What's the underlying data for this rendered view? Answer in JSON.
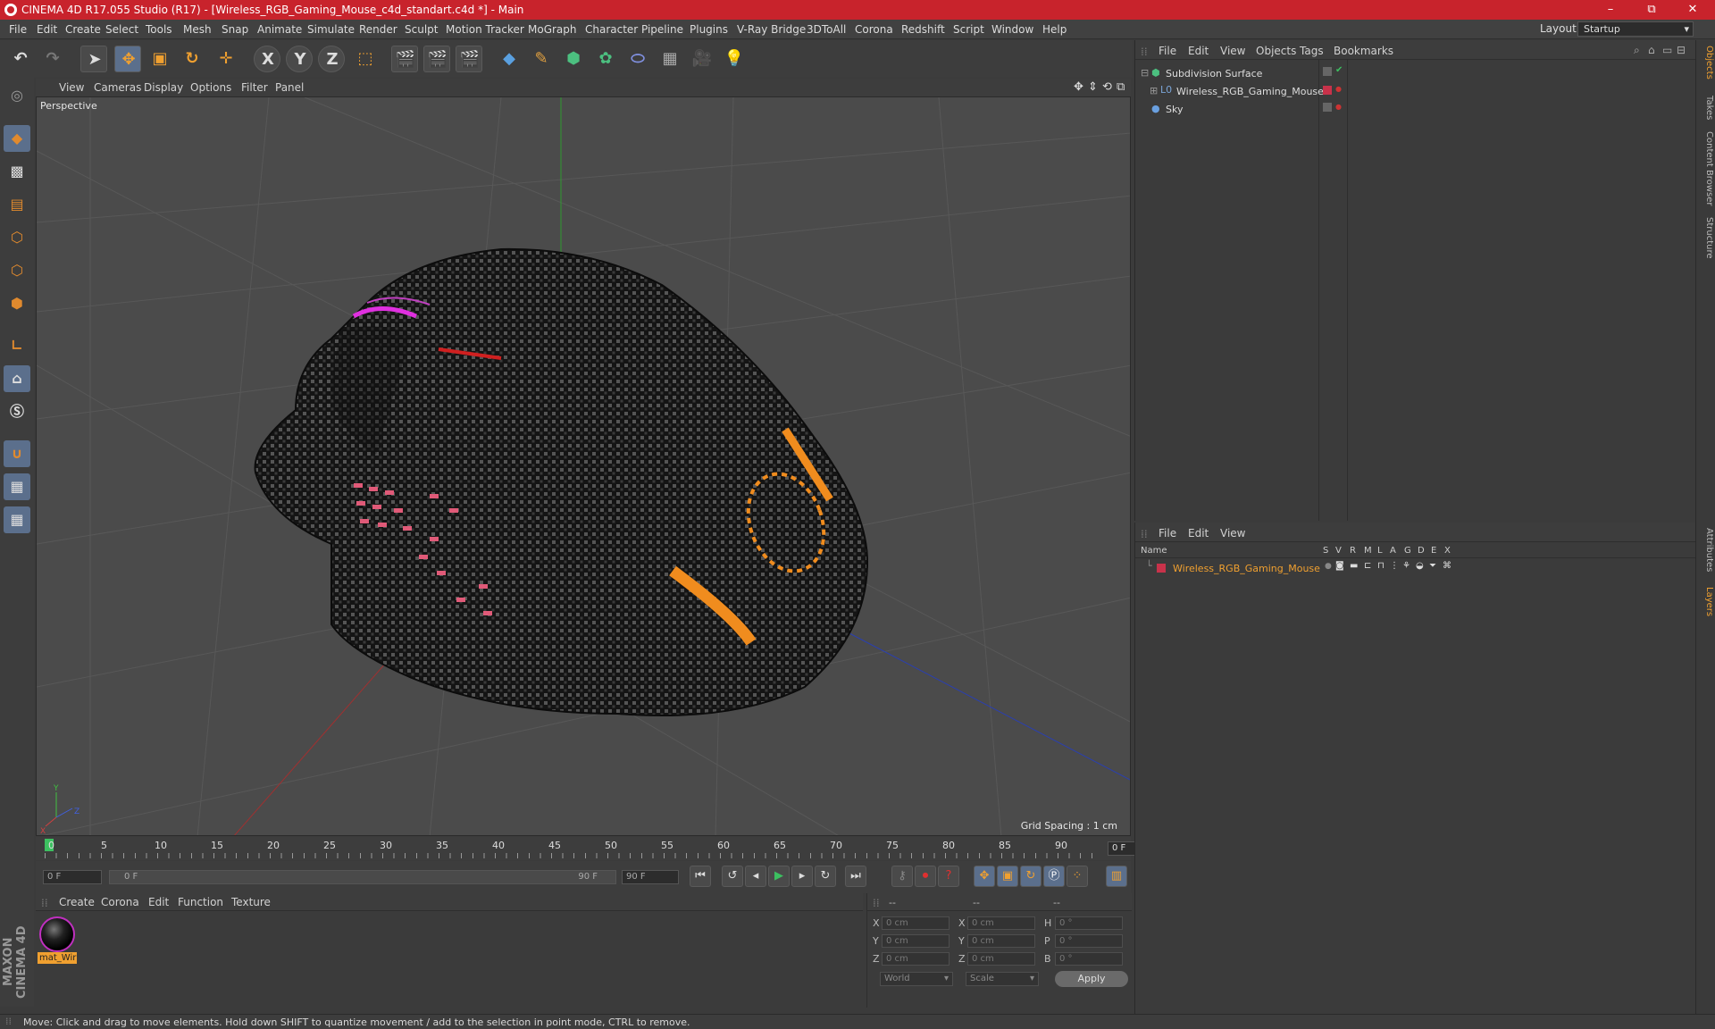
{
  "window": {
    "title": "CINEMA 4D R17.055 Studio (R17) - [Wireless_RGB_Gaming_Mouse_c4d_standart.c4d *] - Main",
    "minimize": "–",
    "restore": "⧉",
    "close": "✕"
  },
  "menu": [
    "File",
    "Edit",
    "Create",
    "Select",
    "Tools",
    "Mesh",
    "Snap",
    "Animate",
    "Simulate",
    "Render",
    "Sculpt",
    "Motion Tracker",
    "MoGraph",
    "Character",
    "Pipeline",
    "Plugins",
    "V-Ray Bridge",
    "3DToAll",
    "Corona",
    "Redshift",
    "Script",
    "Window",
    "Help"
  ],
  "layout": {
    "label": "Layout:",
    "value": "Startup"
  },
  "toolbar": {
    "axis_x": "X",
    "axis_y": "Y",
    "axis_z": "Z"
  },
  "viewport": {
    "menu": [
      "View",
      "Cameras",
      "Display",
      "Options",
      "Filter",
      "Panel"
    ],
    "label": "Perspective",
    "grid_spacing": "Grid Spacing : 1 cm",
    "axis_labels": {
      "y": "Y",
      "x": "X",
      "z": "Z"
    }
  },
  "timeline": {
    "ticks": [
      "0",
      "5",
      "10",
      "15",
      "20",
      "25",
      "30",
      "35",
      "40",
      "45",
      "50",
      "55",
      "60",
      "65",
      "70",
      "75",
      "80",
      "85",
      "90"
    ],
    "current_frame": "0 F",
    "start_field": "0 F",
    "range_start": "0 F",
    "range_end": "90 F",
    "end_field": "90 F"
  },
  "material_manager": {
    "menu": [
      "Create",
      "Corona",
      "Edit",
      "Function",
      "Texture"
    ],
    "material_name": "mat_Wir"
  },
  "coordinates": {
    "headers": [
      "--",
      "--",
      "--"
    ],
    "rows": [
      {
        "l1": "X",
        "v1": "0 cm",
        "l2": "X",
        "v2": "0 cm",
        "l3": "H",
        "v3": "0 °"
      },
      {
        "l1": "Y",
        "v1": "0 cm",
        "l2": "Y",
        "v2": "0 cm",
        "l3": "P",
        "v3": "0 °"
      },
      {
        "l1": "Z",
        "v1": "0 cm",
        "l2": "Z",
        "v2": "0 cm",
        "l3": "B",
        "v3": "0 °"
      }
    ],
    "mode": "World",
    "scale": "Scale",
    "apply": "Apply"
  },
  "object_manager": {
    "menu": [
      "File",
      "Edit",
      "View",
      "Objects",
      "Tags",
      "Bookmarks"
    ],
    "objects": [
      {
        "name": "Subdivision Surface"
      },
      {
        "name": "Wireless_RGB_Gaming_Mouse"
      },
      {
        "name": "Sky"
      }
    ]
  },
  "layer_manager": {
    "menu": [
      "File",
      "Edit",
      "View"
    ],
    "columns": [
      "Name",
      "S",
      "V",
      "R",
      "M",
      "L",
      "A",
      "G",
      "D",
      "E",
      "X"
    ],
    "layer_name": "Wireless_RGB_Gaming_Mouse",
    "layer_color": "#c8324a"
  },
  "right_tabs": [
    "Objects",
    "Takes",
    "Content Browser",
    "Structure",
    "Attributes",
    "Layers"
  ],
  "status": "Move: Click and drag to move elements. Hold down SHIFT to quantize movement / add to the selection in point mode, CTRL to remove.",
  "brand": "MAXON CINEMA 4D",
  "colors": {
    "accent": "#e08a2e",
    "title_bar": "#c8232c",
    "highlight": "#f0a030"
  }
}
